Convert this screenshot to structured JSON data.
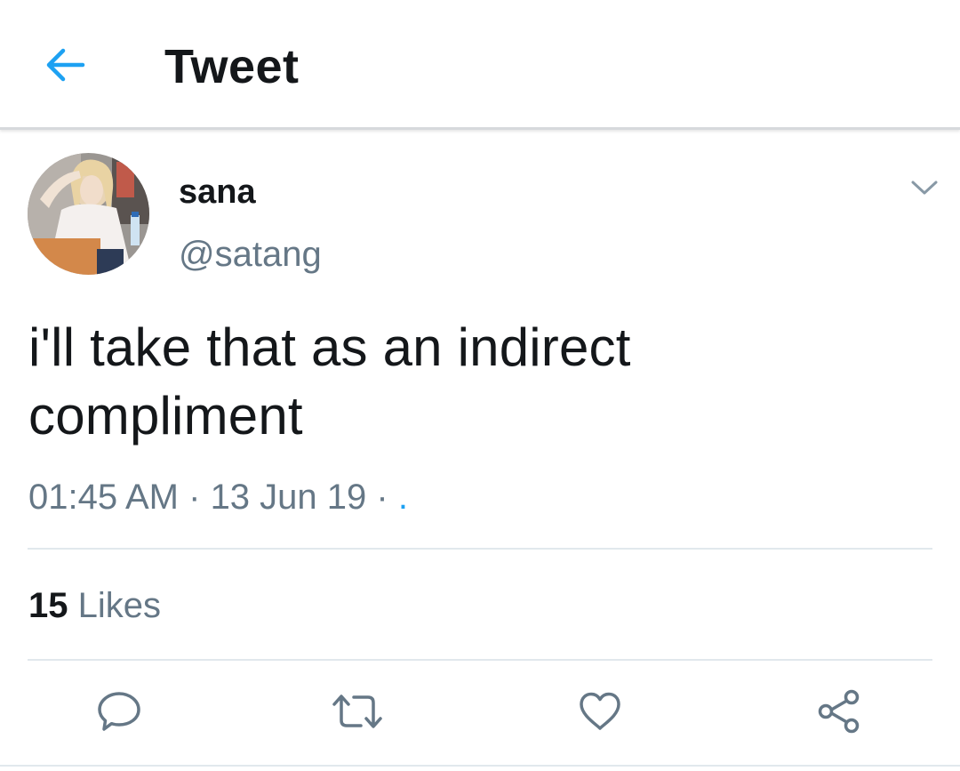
{
  "header": {
    "title": "Tweet",
    "back_icon": "arrow-left-icon",
    "accent_color": "#1da1f2"
  },
  "tweet": {
    "author_name": "sana",
    "author_handle": "@satang",
    "text": "i'll take that as an indirect compliment",
    "time": "01:45 AM",
    "separator": " · ",
    "date": "13 Jun 19",
    "trailing": " · ",
    "trailing_link": ".",
    "likes_count": "15",
    "likes_label": "Likes"
  },
  "actions": {
    "reply_icon": "reply-bubble-icon",
    "retweet_icon": "retweet-icon",
    "like_icon": "heart-icon",
    "share_icon": "share-icon"
  },
  "colors": {
    "text_primary": "#14171a",
    "text_secondary": "#657786",
    "icon_gray": "#657786",
    "divider": "#e1e8ed"
  }
}
